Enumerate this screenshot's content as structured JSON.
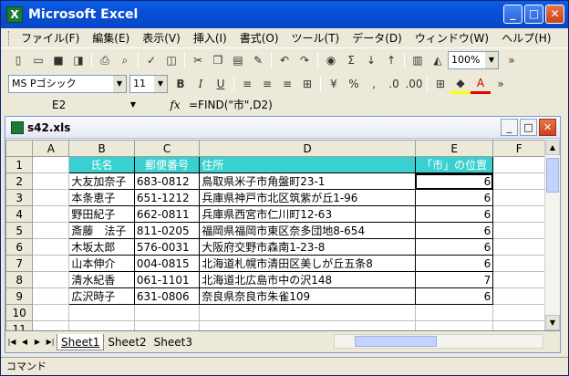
{
  "app": {
    "title": "Microsoft Excel"
  },
  "menu": [
    "ファイル(F)",
    "編集(E)",
    "表示(V)",
    "挿入(I)",
    "書式(O)",
    "ツール(T)",
    "データ(D)",
    "ウィンドウ(W)",
    "ヘルプ(H)"
  ],
  "toolbar": {
    "zoom": "100%",
    "font_name": "MS Pゴシック",
    "font_size": "11",
    "sigma": "Σ"
  },
  "formula_bar": {
    "cell_ref": "E2",
    "fx": "fx",
    "formula": "=FIND(\"市\",D2)"
  },
  "workbook": {
    "name": "s42.xls"
  },
  "sheet": {
    "columns": [
      "A",
      "B",
      "C",
      "D",
      "E",
      "F"
    ],
    "row_numbers": [
      "1",
      "2",
      "3",
      "4",
      "5",
      "6",
      "7",
      "8",
      "9",
      "10",
      "11"
    ],
    "header": {
      "name": "氏名",
      "zip": "郵便番号",
      "address": "住所",
      "position": "「市」の位置"
    },
    "rows": [
      {
        "name": "大友加奈子",
        "zip": "683-0812",
        "address": "鳥取県米子市角盤町23-1",
        "pos": "6"
      },
      {
        "name": "本条恵子",
        "zip": "651-1212",
        "address": "兵庫県神戸市北区筑紫が丘1-96",
        "pos": "6"
      },
      {
        "name": "野田紀子",
        "zip": "662-0811",
        "address": "兵庫県西宮市仁川町12-63",
        "pos": "6"
      },
      {
        "name": "斎藤　法子",
        "zip": "811-0205",
        "address": "福岡県福岡市東区奈多団地8-654",
        "pos": "6"
      },
      {
        "name": "木坂太郎",
        "zip": "576-0031",
        "address": "大阪府交野市森南1-23-8",
        "pos": "6"
      },
      {
        "name": "山本伸介",
        "zip": "004-0815",
        "address": "北海道札幌市清田区美しが丘五条8",
        "pos": "6"
      },
      {
        "name": "清水紀香",
        "zip": "061-1101",
        "address": "北海道北広島市中の沢148",
        "pos": "7"
      },
      {
        "name": "広沢時子",
        "zip": "631-0806",
        "address": "奈良県奈良市朱雀109",
        "pos": "6"
      }
    ]
  },
  "tabs": [
    "Sheet1",
    "Sheet2",
    "Sheet3"
  ],
  "status": "コマンド"
}
